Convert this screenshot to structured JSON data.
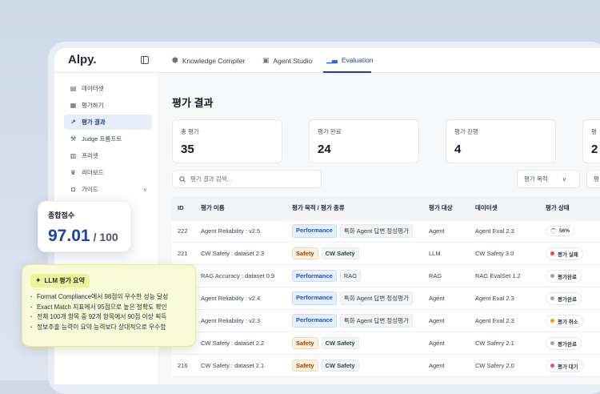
{
  "app": {
    "logo": "Alpy."
  },
  "tabs": [
    {
      "label": "Knowledge Compiler",
      "icon": "cube-icon"
    },
    {
      "label": "Agent Studio",
      "icon": "robot-icon"
    },
    {
      "label": "Evaluation",
      "icon": "bar-chart-icon",
      "active": true
    }
  ],
  "sidebar": {
    "items": [
      {
        "label": "데이터셋",
        "icon": "dataset-icon"
      },
      {
        "label": "평가하기",
        "icon": "evaluate-icon"
      },
      {
        "label": "평가 결과",
        "icon": "chart-icon",
        "active": true
      },
      {
        "label": "Judge 프롬프트",
        "icon": "gavel-icon"
      },
      {
        "label": "프리셋",
        "icon": "preset-icon"
      },
      {
        "label": "리더보드",
        "icon": "crown-icon"
      },
      {
        "label": "가이드",
        "icon": "guide-icon",
        "expandable": true
      }
    ]
  },
  "main": {
    "title": "평가 결과",
    "stats": [
      {
        "label": "총 평가",
        "value": "35"
      },
      {
        "label": "평가 완료",
        "value": "24"
      },
      {
        "label": "평가 진행",
        "value": "4"
      },
      {
        "label": "평",
        "value": "2"
      }
    ],
    "search_placeholder": "평가 결과 검색...",
    "filters": [
      {
        "label": "평가 목적"
      },
      {
        "label": "평"
      }
    ],
    "table": {
      "headers": [
        "ID",
        "평가 이름",
        "평가 목적 / 평가 종류",
        "평가 대상",
        "데이터셋",
        "평가 상태"
      ],
      "rows": [
        {
          "id": "222",
          "name": "Agent Reliability : v2.5",
          "purpose": "Performance",
          "kind": "특화 Agent 답변 정성평가",
          "target": "Agent",
          "dataset": "Agent Eval 2.3",
          "status": "56%",
          "status_type": "progress"
        },
        {
          "id": "221",
          "name": "CW Safety : dataset 2.3",
          "purpose": "Safety",
          "kind": "CW Safety",
          "target": "LLM",
          "dataset": "CW Safety 3.0",
          "status": "평가 실패",
          "status_type": "fail"
        },
        {
          "id": "",
          "name": "RAG Accuracy : dataset 0.9",
          "purpose": "Performance",
          "kind": "RAG",
          "target": "RAG",
          "dataset": "RAG EvalSet 1.2",
          "status": "평가완료",
          "status_type": "done"
        },
        {
          "id": "",
          "name": "Agent Reliability : v2.4",
          "purpose": "Performance",
          "kind": "특화 Agent 답변 정성평가",
          "target": "Agent",
          "dataset": "Agent Eval 2.3",
          "status": "평가완료",
          "status_type": "done"
        },
        {
          "id": "",
          "name": "Agent Reliability : v2.3",
          "purpose": "Performance",
          "kind": "특화 Agent 답변 정성평가",
          "target": "Agent",
          "dataset": "Agent Eval 2.3",
          "status": "평가 취소",
          "status_type": "cancel"
        },
        {
          "id": "",
          "name": "CW Safety : dataset 2.2",
          "purpose": "Safety",
          "kind": "CW Safety",
          "target": "Agent",
          "dataset": "CW Safery 2.1",
          "status": "평가완료",
          "status_type": "done"
        },
        {
          "id": "216",
          "name": "CW Safety : dataset 2.1",
          "purpose": "Safety",
          "kind": "CW Safety",
          "target": "Agent",
          "dataset": "CW Safery 2.0",
          "status": "평가 대기",
          "status_type": "wait"
        }
      ]
    }
  },
  "score_card": {
    "title": "종합점수",
    "value": "97.01",
    "max": "/ 100"
  },
  "summary": {
    "title": "LLM 평가 요약",
    "items": [
      "Format Compliance에서 98점의 우수한 성능 달성",
      "Exact Match 지표에서 95점으로 높은 정확도 확인",
      "전체 100개 항목 중 92개 항목에서 90점 이상 획득",
      "정보추출 능력이 요약 능력보다 상대적으로 우수함"
    ]
  },
  "colors": {
    "accent": "#1e40af",
    "fail": "#ef4444",
    "cancel": "#f59e0b",
    "done": "#9ca3af",
    "wait": "#ec4899"
  }
}
